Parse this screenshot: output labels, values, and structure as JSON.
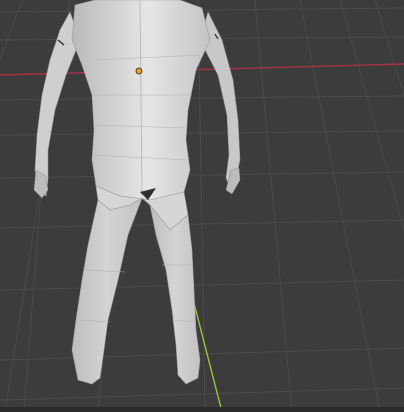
{
  "viewport": {
    "background": "#3c3c3c",
    "grid_color": "#4a4a4a",
    "x_axis_color": "#b03048",
    "y_axis_color": "#8fb83a",
    "origin_color": "#f0a020",
    "mesh_color": "#d8d8d8",
    "mesh_shadow": "#a9a9a9"
  },
  "scene": {
    "object_icon": "humanoid-mesh",
    "origin_icon": "object-origin-dot"
  }
}
